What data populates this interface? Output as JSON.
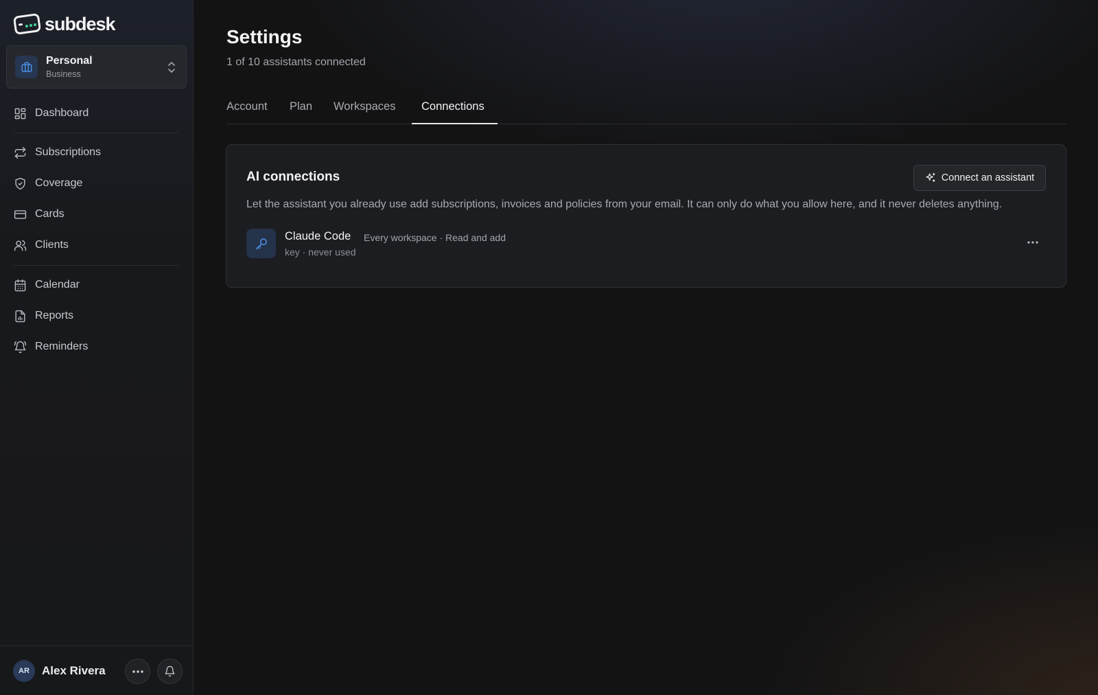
{
  "brand": {
    "name": "subdesk",
    "logo_icon": "subdesk-logo-icon"
  },
  "workspace": {
    "name": "Personal",
    "type": "Business",
    "icon": "briefcase-icon"
  },
  "sidebar": {
    "items": [
      {
        "label": "Dashboard",
        "icon": "grid-icon"
      },
      {
        "label": "Subscriptions",
        "icon": "repeat-icon"
      },
      {
        "label": "Coverage",
        "icon": "shield-check-icon"
      },
      {
        "label": "Cards",
        "icon": "credit-card-icon"
      },
      {
        "label": "Clients",
        "icon": "users-icon"
      },
      {
        "label": "Calendar",
        "icon": "calendar-icon"
      },
      {
        "label": "Reports",
        "icon": "file-chart-icon"
      },
      {
        "label": "Reminders",
        "icon": "bell-ring-icon"
      }
    ]
  },
  "user": {
    "initials": "AR",
    "name": "Alex Rivera"
  },
  "page": {
    "title": "Settings",
    "subtitle": "1 of 10 assistants connected"
  },
  "tabs": [
    {
      "label": "Account",
      "active": false
    },
    {
      "label": "Plan",
      "active": false
    },
    {
      "label": "Workspaces",
      "active": false
    },
    {
      "label": "Connections",
      "active": true
    }
  ],
  "ai_connections": {
    "title": "AI connections",
    "connect_button": "Connect an assistant",
    "description": "Let the assistant you already use add subscriptions, invoices and policies from your email. It can only do what you allow here, and it never deletes anything.",
    "connections": [
      {
        "name": "Claude Code",
        "meta": "Every workspace · Read and add",
        "sub": "key · never used",
        "icon": "key-icon"
      }
    ]
  },
  "colors": {
    "accent": "#4a8fe0",
    "background": "#131314",
    "sidebar": "#18191c",
    "card": "#1c1d20"
  }
}
